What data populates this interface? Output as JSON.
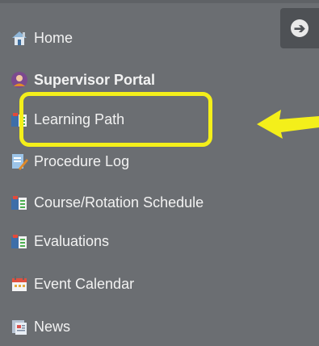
{
  "sidebar": {
    "collapse_icon": "arrow-left-circle-icon",
    "items": [
      {
        "label": "Home",
        "icon": "home-icon"
      },
      {
        "label": "Supervisor Portal",
        "icon": "supervisor-icon"
      },
      {
        "label": "Learning Path",
        "icon": "folder-document-icon"
      },
      {
        "label": "Procedure Log",
        "icon": "notepad-pencil-icon"
      },
      {
        "label": "Course/Rotation Schedule",
        "icon": "folder-document-icon"
      },
      {
        "label": "Evaluations",
        "icon": "folder-document-icon"
      },
      {
        "label": "Event Calendar",
        "icon": "calendar-icon"
      },
      {
        "label": "News",
        "icon": "newspaper-icon"
      }
    ]
  },
  "annotation": {
    "highlight_color": "#f4ef1a",
    "arrow_icon": "arrow-left-icon"
  }
}
